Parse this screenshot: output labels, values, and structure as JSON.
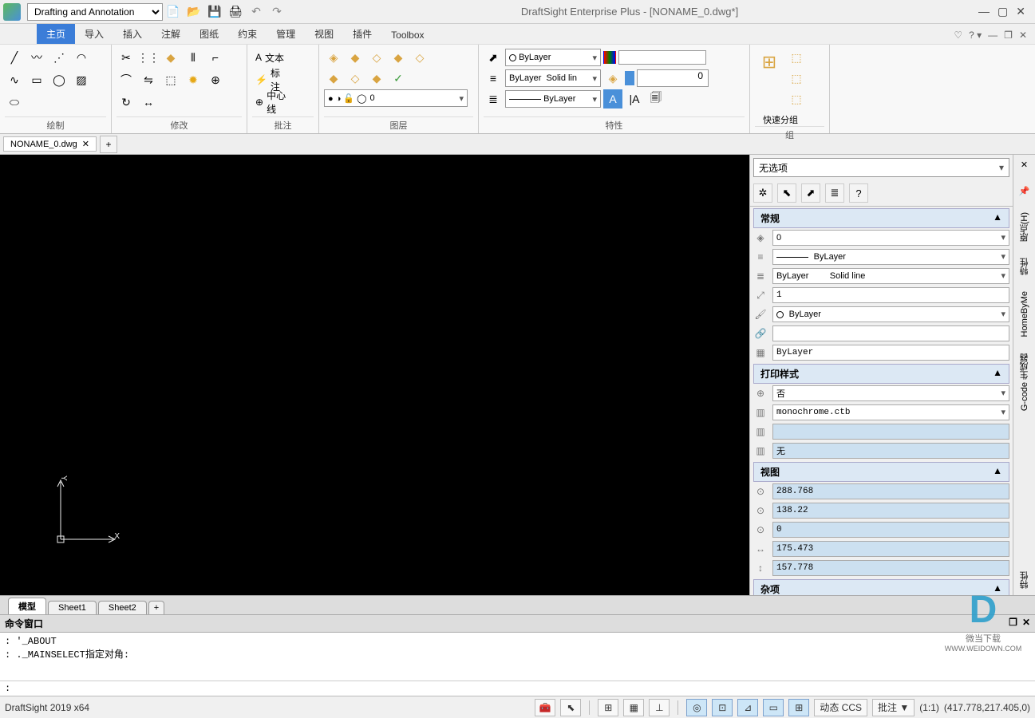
{
  "title": "DraftSight Enterprise Plus - [NONAME_0.dwg*]",
  "workspace": "Drafting and Annotation",
  "tabs": [
    "主页",
    "导入",
    "插入",
    "注解",
    "图纸",
    "约束",
    "管理",
    "视图",
    "插件",
    "Toolbox"
  ],
  "active_tab": "主页",
  "panels": {
    "draw": "绘制",
    "modify": "修改",
    "annotate": "批注",
    "layer": "图层",
    "properties": "特性",
    "group": "组"
  },
  "annotate_buttons": {
    "text": "文本",
    "dim": "标注",
    "centerline": "中心线"
  },
  "layer_current": "0",
  "layer_state_indicators": "● ◑ 🔓 ◯",
  "prop_color": "ByLayer",
  "prop_linetype": {
    "label": "ByLayer",
    "style": "Solid lin"
  },
  "prop_lineweight": "ByLayer",
  "prop_transparency_value": "0",
  "group_label": "快速分组",
  "doc_tab": "NONAME_0.dwg",
  "doc_tab_close": "✕",
  "prop_header_select": "无选项",
  "sections": {
    "general": "常规",
    "printstyle": "打印样式",
    "view": "视图",
    "misc": "杂项"
  },
  "general_rows": {
    "layer": "0",
    "linetype": "ByLayer",
    "linestyle": {
      "name": "ByLayer",
      "style": "Solid line"
    },
    "scale": "1",
    "color": "ByLayer",
    "hyperlink": "",
    "lineweight": "ByLayer"
  },
  "printstyle_rows": {
    "ps1": "否",
    "ps2": "monochrome.ctb",
    "ps3": "",
    "ps4": "无"
  },
  "view_rows": {
    "centerx": "288.768",
    "centery": "138.22",
    "centerz": "0",
    "width": "175.473",
    "height": "157.778"
  },
  "side_rail": [
    "原点(H)",
    "特性",
    "HomeByMe",
    "G-code 生成器"
  ],
  "side_rail_extra": "特性",
  "sheet_tabs": [
    "模型",
    "Sheet1",
    "Sheet2"
  ],
  "sheet_add": "+",
  "cmd_window_title": "命令窗口",
  "cmd_lines": ": '_ABOUT\n: ._MAINSELECT指定对角:",
  "cmd_prompt": ":",
  "status_left": "DraftSight 2019 x64",
  "status_ccs": "动态 CCS",
  "status_annot": "批注  ▼",
  "status_ratio": "(1:1)",
  "status_coords": "(417.778,217.405,0)",
  "ucs": {
    "x": "X",
    "y": "Y"
  },
  "watermark": {
    "brand": "微当下载",
    "url": "WWW.WEIDOWN.COM"
  }
}
